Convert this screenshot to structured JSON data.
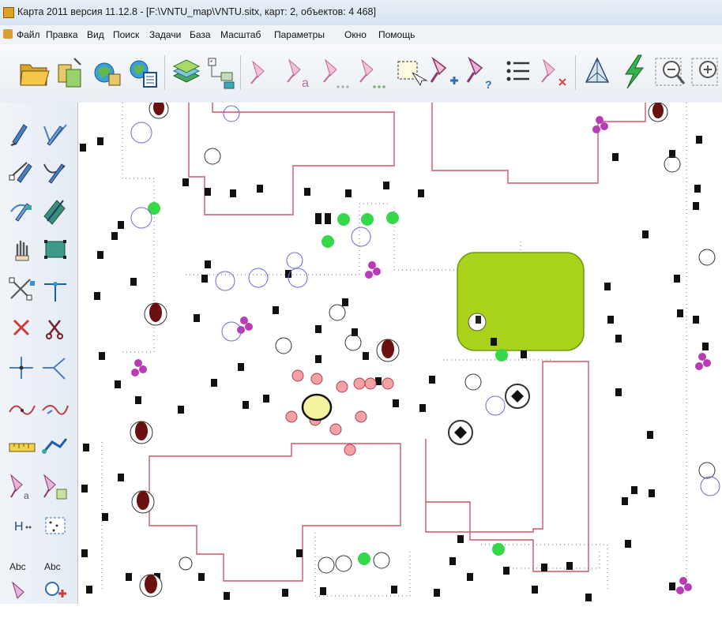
{
  "window": {
    "title": "Карта 2011 версия 11.12.8 - [F:\\VNTU_map\\VNTU.sitx, карт: 2, объектов: 4 468]"
  },
  "menu": {
    "items": [
      "Файл",
      "Правка",
      "Вид",
      "Поиск",
      "Задачи",
      "База",
      "Масштаб",
      "Параметры",
      "Окно",
      "Помощь"
    ]
  },
  "toolbar": {
    "buttons": [
      "open-map",
      "open-data",
      "open-site",
      "open-site-list",
      "layers",
      "add-layer",
      "select-object",
      "select-object-label",
      "select-more",
      "select-more-2",
      "select-region",
      "add-object",
      "object-info",
      "list",
      "delete-selection",
      "triangulation",
      "lightning",
      "zoom-out",
      "zoom-in"
    ]
  },
  "lefttools": {
    "buttons": [
      "create-line",
      "create-line-2",
      "edit-node",
      "edit-node-2",
      "move-node",
      "move-object",
      "hand",
      "frame",
      "cut",
      "split",
      "delete",
      "scissors",
      "cross",
      "branch",
      "curve",
      "curve-2",
      "ruler",
      "transform",
      "point-label",
      "cross-select",
      "height",
      "grid",
      "text",
      "text-2",
      "sign",
      "sign-add"
    ],
    "labels": {
      "height": "H",
      "text": "Abc",
      "text_2": "Abc"
    }
  },
  "colors": {
    "building_outline": "#c85a6a",
    "lawn_fill": "#a9d21b",
    "lawn_stroke": "#6e9a10",
    "green_point": "#35d848",
    "tree_symbol": "#6b1010",
    "flower_symbol": "#b73cb3",
    "pink_circle": "#f4a2a6"
  }
}
